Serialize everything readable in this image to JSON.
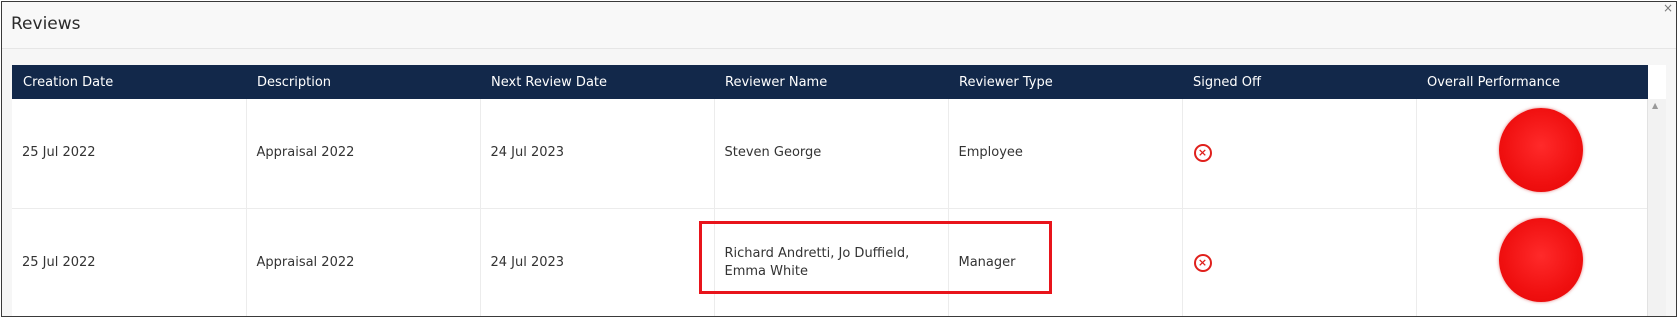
{
  "panel": {
    "title": "Reviews",
    "close_glyph": "×"
  },
  "table": {
    "columns": [
      "Creation Date",
      "Description",
      "Next Review Date",
      "Reviewer Name",
      "Reviewer Type",
      "Signed Off",
      "Overall Performance"
    ],
    "rows": [
      {
        "creation_date": "25 Jul 2022",
        "description": "Appraisal 2022",
        "next_review_date": "24 Jul 2023",
        "reviewer_name": "Steven George",
        "reviewer_type": "Employee",
        "signed_off": "no",
        "signed_off_glyph": "×",
        "overall_performance_color": "#f01010"
      },
      {
        "creation_date": "25 Jul 2022",
        "description": "Appraisal 2022",
        "next_review_date": "24 Jul 2023",
        "reviewer_name": "Richard Andretti, Jo Duffield, Emma White",
        "reviewer_type": "Manager",
        "signed_off": "no",
        "signed_off_glyph": "×",
        "overall_performance_color": "#f01010"
      }
    ]
  },
  "scrollbar": {
    "up_glyph": "▲"
  },
  "colors": {
    "header_bg": "#12284a",
    "performance_red": "#f01010",
    "annotation_red": "#e8141b"
  }
}
